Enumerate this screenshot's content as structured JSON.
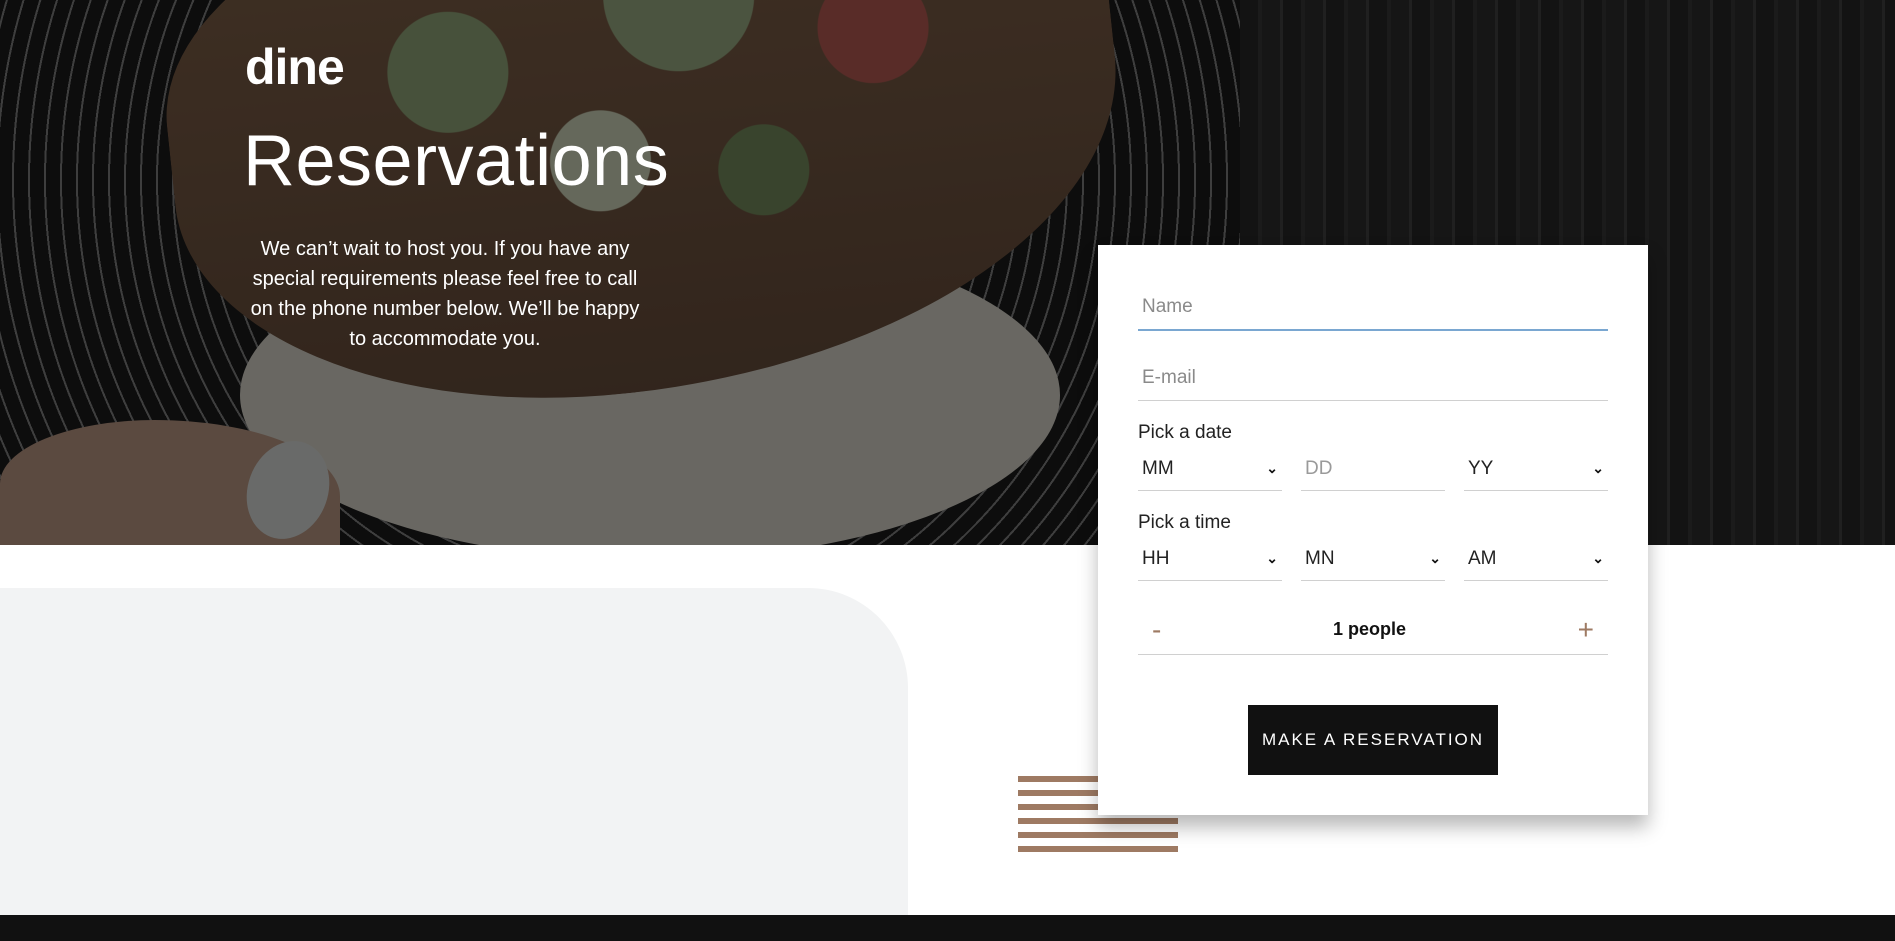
{
  "brand": {
    "logo": "dine"
  },
  "hero": {
    "title": "Reservations",
    "intro": "We can’t wait to host you. If you have any special requirements please feel free to call on the phone number below. We’ll be happy to accommodate you."
  },
  "form": {
    "name_placeholder": "Name",
    "email_placeholder": "E-mail",
    "date_label": "Pick a date",
    "date_month": "MM",
    "date_day": "DD",
    "date_year": "YY",
    "time_label": "Pick a time",
    "time_hour": "HH",
    "time_minute": "MN",
    "time_period": "AM",
    "people_minus": "-",
    "people_count": "1 people",
    "people_plus": "+",
    "submit_label": "MAKE A RESERVATION"
  },
  "colors": {
    "accent": "#9e7a63",
    "button_bg": "#111111",
    "focus_underline": "#7aa7d1",
    "panel_grey": "#f2f3f4"
  },
  "icons": {
    "dropdown": "chevron-down-icon"
  }
}
